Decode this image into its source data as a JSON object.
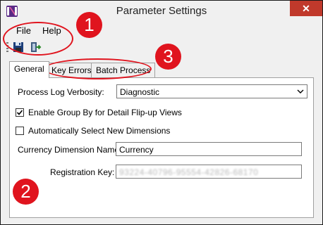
{
  "window": {
    "title": "Parameter Settings",
    "close_glyph": "✕"
  },
  "menu": {
    "items": [
      "File",
      "Help"
    ]
  },
  "toolbar": {
    "buttons": [
      "save-icon",
      "exit-icon"
    ]
  },
  "tabs": [
    {
      "label": "General",
      "active": true
    },
    {
      "label": "Key Errors",
      "active": false
    },
    {
      "label": "Batch Process",
      "active": false
    }
  ],
  "general": {
    "verbosity_label": "Process Log Verbosity:",
    "verbosity_value": "Diagnostic",
    "group_by_label": "Enable Group By for Detail Flip-up Views",
    "group_by_checked": true,
    "auto_select_label": "Automatically Select New Dimensions",
    "auto_select_checked": false,
    "currency_label": "Currency Dimension Name:",
    "currency_value": "Currency",
    "registration_label": "Registration Key:",
    "registration_value": "93224-40796-95554-42826-68170"
  },
  "annotations": {
    "badge1": "1",
    "badge2": "2",
    "badge3": "3",
    "color": "#e0141e"
  }
}
